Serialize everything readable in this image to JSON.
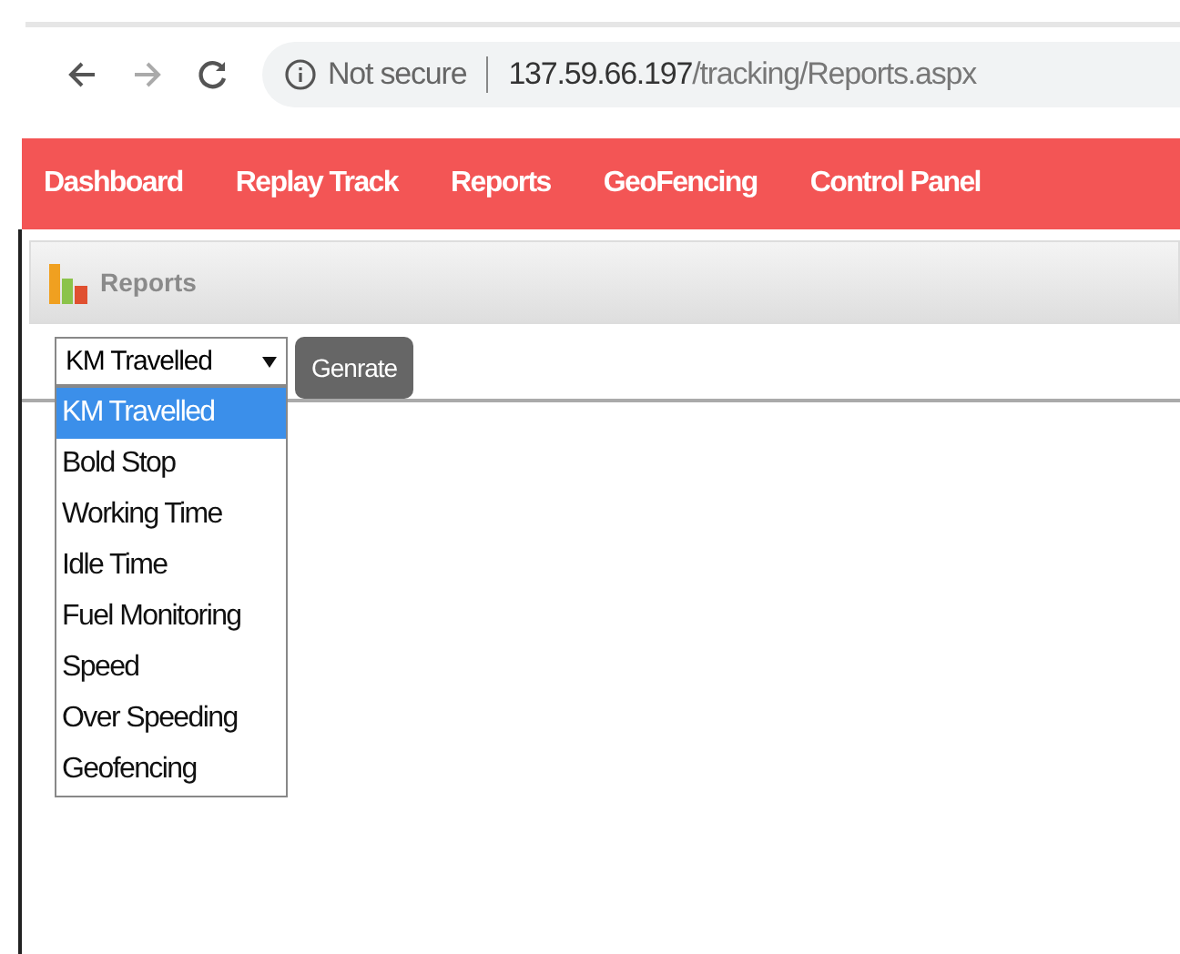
{
  "browser": {
    "security": "Not secure",
    "url_host": "137.59.66.197",
    "url_path": "/tracking/Reports.aspx"
  },
  "nav": [
    {
      "label": "Dashboard"
    },
    {
      "label": "Replay Track"
    },
    {
      "label": "Reports"
    },
    {
      "label": "GeoFencing"
    },
    {
      "label": "Control Panel"
    }
  ],
  "panel": {
    "title": "Reports"
  },
  "report_select": {
    "value": "KM Travelled",
    "options": [
      {
        "label": "KM Travelled",
        "selected": true
      },
      {
        "label": "Bold Stop",
        "selected": false
      },
      {
        "label": "Working Time",
        "selected": false
      },
      {
        "label": "Idle Time",
        "selected": false
      },
      {
        "label": "Fuel Monitoring",
        "selected": false
      },
      {
        "label": "Speed",
        "selected": false
      },
      {
        "label": "Over Speeding",
        "selected": false
      },
      {
        "label": "Geofencing",
        "selected": false
      }
    ]
  },
  "generate_button": "Genrate"
}
